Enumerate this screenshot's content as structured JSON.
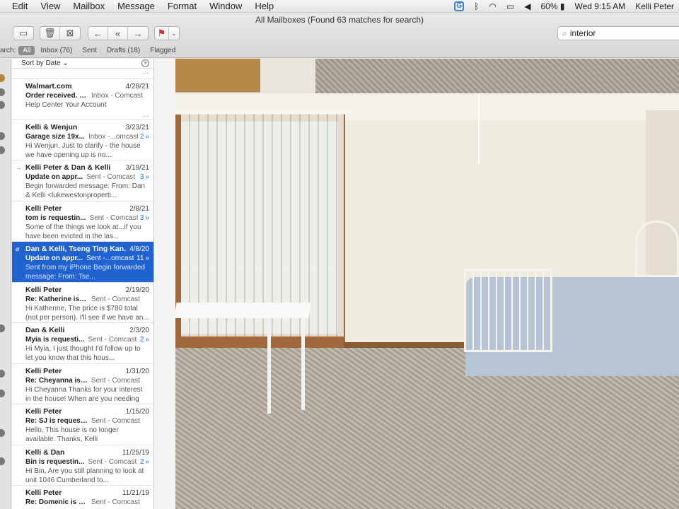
{
  "menubar": {
    "items": [
      "Edit",
      "View",
      "Mailbox",
      "Message",
      "Format",
      "Window",
      "Help"
    ],
    "status": {
      "battery": "60%",
      "datetime": "Wed 9:15 AM",
      "user": "Kelli Peter"
    }
  },
  "window": {
    "title": "All Mailboxes (Found 63 matches for search)"
  },
  "search": {
    "value": "interior"
  },
  "scope": {
    "label": "arch:",
    "items": [
      "All",
      "Inbox (76)",
      "Sent",
      "Drafts (18)",
      "Flagged"
    ]
  },
  "list": {
    "sort_label": "Sort by Date",
    "messages": [
      {
        "from": "Walmart.com",
        "date": "4/28/21",
        "subject": "Order received. Colo...",
        "mailbox": "Inbox - Comcast",
        "count": "",
        "preview": "Help Center Your Account"
      },
      {
        "from": "Kelli & Wenjun",
        "date": "3/23/21",
        "subject": "Garage size 19x...",
        "mailbox": "Inbox -...omcast",
        "count": "2",
        "preview": "Hi Wenjun, Just to clarify - the house we have opening up is no..."
      },
      {
        "from": "Kelli Peter & Dan & Kelli",
        "date": "3/19/21",
        "subject": "Update on appr...",
        "mailbox": "Sent - Comcast",
        "count": "3",
        "preview": "Begin forwarded message: From: Dan & Kelli <lukewestonproperti..."
      },
      {
        "from": "Kelli Peter",
        "date": "2/8/21",
        "subject": "tom is requestin...",
        "mailbox": "Sent - Comcast",
        "count": "3",
        "preview": "Some of the things we look at...if you have been evicted in the las..."
      },
      {
        "from": "Dan & Kelli, Tseng Ting Kan...",
        "date": "4/8/20",
        "subject": "Update on appr...",
        "mailbox": "Sent -...omcast",
        "count": "11",
        "preview": "Sent from my iPhone Begin forwarded message: From: Tse..."
      },
      {
        "from": "Kelli Peter",
        "date": "2/19/20",
        "subject": "Re: Katherine is requ...",
        "mailbox": "Sent - Comcast",
        "count": "",
        "preview": "Hi Katherine, The price is $780 total (not per person). I'll see if we have an..."
      },
      {
        "from": "Dan & Kelli",
        "date": "2/3/20",
        "subject": "Myia is requesti...",
        "mailbox": "Sent - Comcast",
        "count": "2",
        "preview": "Hi Myia, I just thought I'd follow up to let you know that this hous..."
      },
      {
        "from": "Kelli Peter",
        "date": "1/31/20",
        "subject": "Re: Cheyanna is requ...",
        "mailbox": "Sent - Comcast",
        "count": "",
        "preview": "Hi Cheyanna Thanks for your interest in the house! When are you needing a..."
      },
      {
        "from": "Kelli Peter",
        "date": "1/15/20",
        "subject": "Re: SJ is requesting i...",
        "mailbox": "Sent - Comcast",
        "count": "",
        "preview": "Hello, This house is no longer available. Thanks, Kelli"
      },
      {
        "from": "Kelli & Dan",
        "date": "11/25/19",
        "subject": "Bin is requestin...",
        "mailbox": "Sent - Comcast",
        "count": "2",
        "preview": "Hi Bin, Are you still planning to look at unit 1046 Cumberland to..."
      },
      {
        "from": "Kelli Peter",
        "date": "11/21/19",
        "subject": "Re: Domenic is reque...",
        "mailbox": "Sent - Comcast",
        "count": "",
        "preview": ""
      }
    ]
  },
  "icons": {
    "archive": "▭",
    "trash": "🗑",
    "junk": "⊠",
    "reply": "←",
    "reply_all": "«",
    "forward": "→",
    "flag": "⚑",
    "search": "⌕",
    "bluetooth": "ᛒ",
    "wifi": "◠",
    "airplay": "▭",
    "volume": "◀",
    "battery": "▮",
    "arrow_marker": "→",
    "attach_marker": "⌀"
  },
  "colors": {
    "selection": "#1f62d0",
    "thread_count": "#2a73d6",
    "flag": "#e0262a"
  }
}
